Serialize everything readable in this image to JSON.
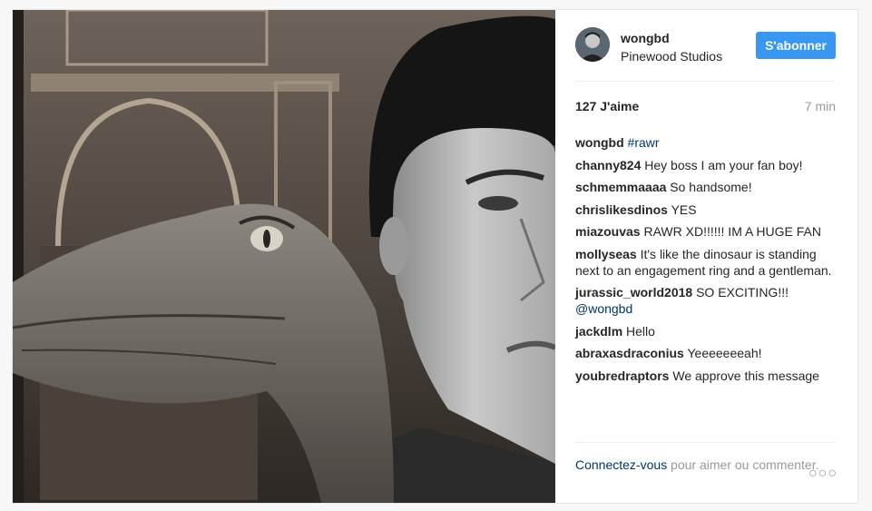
{
  "post": {
    "username": "wongbd",
    "location": "Pinewood Studios",
    "follow_label": "S'abonner",
    "likes": "127 J'aime",
    "time": "7 min",
    "caption": {
      "author": "wongbd",
      "text": "#rawr"
    },
    "comments": [
      {
        "author": "channy824",
        "text": "Hey boss I am your fan boy!"
      },
      {
        "author": "schmemmaaaa",
        "text": "So handsome!"
      },
      {
        "author": "chrislikesdinos",
        "text": "YES"
      },
      {
        "author": "miazouvas",
        "text": "RAWR XD!!!!!! IM A HUGE FAN"
      },
      {
        "author": "mollyseas",
        "text": "It's like the dinosaur is standing next to an engagement ring and a gentleman."
      },
      {
        "author": "jurassic_world2018",
        "text": "SO EXCITING!!!",
        "mention": "@wongbd"
      },
      {
        "author": "jackdlm",
        "text": "Hello"
      },
      {
        "author": "abraxasdraconius",
        "text": "Yeeeeeeeah!"
      },
      {
        "author": "youbredraptors",
        "text": "We approve this message"
      }
    ],
    "login_prompt": {
      "link": "Connectez-vous",
      "rest": " pour aimer ou commenter."
    },
    "more_icon": "more-options-icon"
  },
  "colors": {
    "accent": "#3897f0",
    "link": "#003569",
    "muted": "#999999"
  }
}
